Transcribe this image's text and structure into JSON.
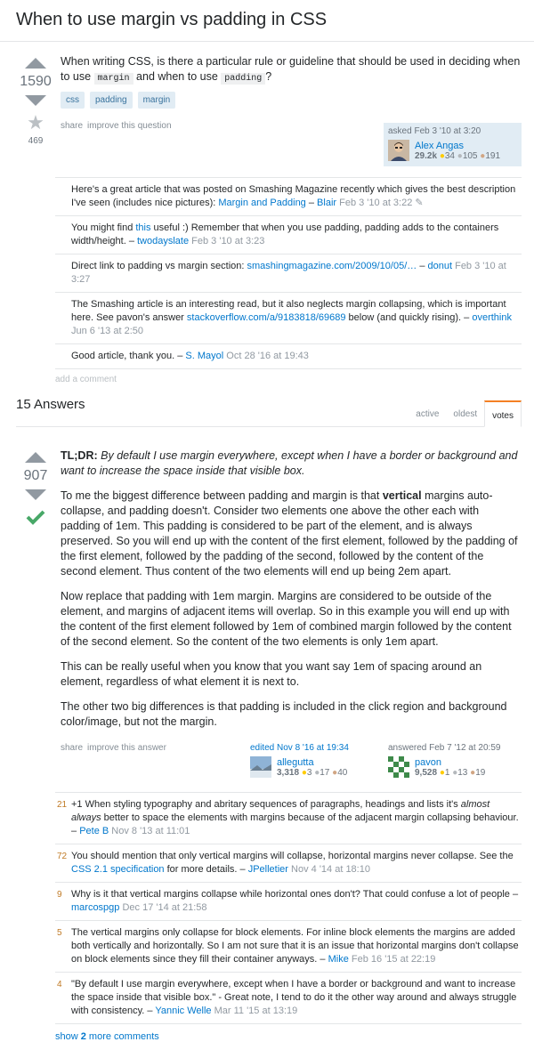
{
  "question": {
    "title": "When to use margin vs padding in CSS",
    "votes": "1590",
    "favorites": "469",
    "body_1": "When writing CSS, is there a particular rule or guideline that should be used in deciding when to use",
    "code_margin": "margin",
    "body_2": "and when to use",
    "code_padding": "padding",
    "body_3": "?",
    "tags": [
      "css",
      "padding",
      "margin"
    ],
    "menu": {
      "share": "share",
      "improve": "improve this question"
    },
    "asked": {
      "action": "asked Feb 3 '10 at 3:20",
      "name": "Alex Angas",
      "rep": "29.2k",
      "gold": "34",
      "silver": "105",
      "bronze": "191"
    },
    "comments": [
      {
        "score": "",
        "text": "Here's a great article that was posted on Smashing Magazine recently which gives the best description I've seen (includes nice pictures): ",
        "link": "Margin and Padding",
        "sep": " – ",
        "user": "Blair",
        "date": "Feb 3 '10 at 3:22",
        "edit": "✎"
      },
      {
        "score": "",
        "pre": "You might find ",
        "link": "this",
        "text": " useful :) Remember that when you use padding, padding adds to the containers width/height.",
        "sep": " – ",
        "user": "twodayslate",
        "date": "Feb 3 '10 at 3:23"
      },
      {
        "score": "",
        "text": "Direct link to padding vs margin section: ",
        "link": "smashingmagazine.com/2009/10/05/…",
        "sep": " – ",
        "user": "donut",
        "date": "Feb 3 '10 at 3:27"
      },
      {
        "score": "",
        "text": "The Smashing article is an interesting read, but it also neglects margin collapsing, which is important here. See pavon's answer ",
        "link": "stackoverflow.com/a/9183818/69689",
        "post": " below (and quickly rising).",
        "sep": " – ",
        "user": "overthink",
        "date": "Jun 6 '13 at 2:50"
      },
      {
        "score": "",
        "text": "Good article, thank you.",
        "sep": " – ",
        "user": "S. Mayol",
        "date": "Oct 28 '16 at 19:43"
      }
    ],
    "add_comment": "add a comment"
  },
  "answers_header": {
    "count": "15 Answers",
    "tabs": [
      "active",
      "oldest",
      "votes"
    ]
  },
  "answer": {
    "votes": "907",
    "tldr_label": "TL;DR:",
    "tldr_text": " By default I use margin everywhere, except when I have a border or background and want to increase the space inside that visible box.",
    "p1_a": "To me the biggest difference between padding and margin is that ",
    "p1_bold": "vertical",
    "p1_b": " margins auto-collapse, and padding doesn't. Consider two elements one above the other each with padding of 1em. This padding is considered to be part of the element, and is always preserved. So you will end up with the content of the first element, followed by the padding of the first element, followed by the padding of the second, followed by the content of the second element. Thus content of the two elements will end up being 2em apart.",
    "p2": "Now replace that padding with 1em margin. Margins are considered to be outside of the element, and margins of adjacent items will overlap. So in this example you will end up with the content of the first element followed by 1em of combined margin followed by the content of the second element. So the content of the two elements is only 1em apart.",
    "p3": "This can be really useful when you know that you want say 1em of spacing around an element, regardless of what element it is next to.",
    "p4": "The other two big differences is that padding is included in the click region and background color/image, but not the margin.",
    "menu": {
      "share": "share",
      "improve": "improve this answer"
    },
    "edited": {
      "action": "edited Nov 8 '16 at 19:34",
      "name": "allegutta",
      "rep": "3,318",
      "gold": "3",
      "silver": "17",
      "bronze": "40"
    },
    "answered": {
      "action": "answered Feb 7 '12 at 20:59",
      "name": "pavon",
      "rep": "9,528",
      "gold": "1",
      "silver": "13",
      "bronze": "19"
    },
    "comments": [
      {
        "score": "21",
        "pre": "+1 When styling typography and abritary sequences of paragraphs, headings and lists it's ",
        "em": "almost always",
        "text": " better to space the elements with margins because of the adjacent margin collapsing behaviour.",
        "sep": " – ",
        "user": "Pete B",
        "date": "Nov 8 '13 at 11:01"
      },
      {
        "score": "72",
        "text": "You should mention that only vertical margins will collapse, horizontal margins never collapse. See the ",
        "link": "CSS 2.1 specification",
        "post": " for more details.",
        "sep": " – ",
        "user": "JPelletier",
        "date": "Nov 4 '14 at 18:10"
      },
      {
        "score": "9",
        "text": "Why is it that vertical margins collapse while horizontal ones don't? That could confuse a lot of people",
        "sep": " – ",
        "user": "marcospgp",
        "date": "Dec 17 '14 at 21:58"
      },
      {
        "score": "5",
        "text": "The vertical margins only collapse for block elements. For inline block elements the margins are added both vertically and horizontally. So I am not sure that it is an issue that horizontal margins don't collapse on block elements since they fill their container anyways.",
        "sep": " – ",
        "user": "Mike",
        "date": "Feb 16 '15 at 22:19"
      },
      {
        "score": "4",
        "text": "\"By default I use margin everywhere, except when I have a border or background and want to increase the space inside that visible box.\" - Great note, I tend to do it the other way around and always struggle with consistency.",
        "sep": " – ",
        "user": "Yannic Welle",
        "date": "Mar 11 '15 at 13:19"
      }
    ],
    "show_more_pre": "show ",
    "show_more_num": "2",
    "show_more_post": " more comments"
  },
  "colors": {
    "link": "#0077cc",
    "accent": "#f48024",
    "accepted": "#48a868",
    "tag_bg": "#e1ecf4"
  }
}
